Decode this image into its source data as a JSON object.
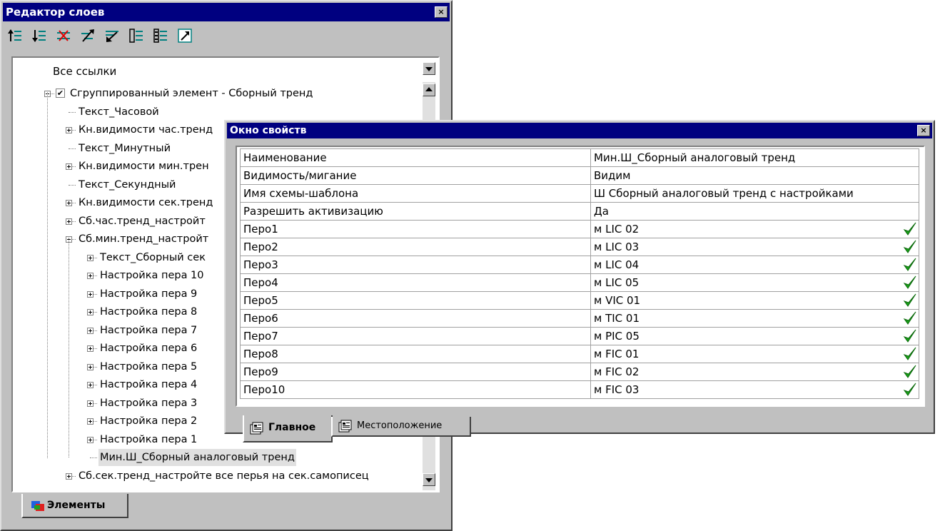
{
  "layer_editor": {
    "title": "Редактор слоев",
    "close": "×",
    "toolbar_icons": [
      "move-up-icon",
      "move-down-icon",
      "delete-link-icon",
      "link-up-icon",
      "link-down-icon",
      "list-icon",
      "numbered-list-icon",
      "jump-icon"
    ],
    "header": "Все ссылки",
    "tree": [
      {
        "label": "Сгруппированный элемент - Сборный тренд",
        "level": 0,
        "expander": "minus",
        "checked": true
      },
      {
        "label": "Текст_Часовой",
        "level": 1,
        "expander": ""
      },
      {
        "label": "Кн.видимости час.тренд",
        "level": 1,
        "expander": "plus"
      },
      {
        "label": " Текст_Минутный",
        "level": 1,
        "expander": ""
      },
      {
        "label": "Кн.видимости мин.трен",
        "level": 1,
        "expander": "plus"
      },
      {
        "label": "Текст_Секундный",
        "level": 1,
        "expander": ""
      },
      {
        "label": "Кн.видимости сек.тренд",
        "level": 1,
        "expander": "plus"
      },
      {
        "label": " Сб.час.тренд_настройт",
        "level": 1,
        "expander": "plus"
      },
      {
        "label": " Сб.мин.тренд_настройт",
        "level": 1,
        "expander": "minus"
      },
      {
        "label": "Текст_Сборный сек",
        "level": 2,
        "expander": "plus"
      },
      {
        "label": "Настройка пера 10",
        "level": 2,
        "expander": "plus"
      },
      {
        "label": "Настройка пера 9",
        "level": 2,
        "expander": "plus"
      },
      {
        "label": "Настройка пера 8",
        "level": 2,
        "expander": "plus"
      },
      {
        "label": "Настройка пера 7",
        "level": 2,
        "expander": "plus"
      },
      {
        "label": "Настройка пера 6",
        "level": 2,
        "expander": "plus"
      },
      {
        "label": "Настройка пера 5",
        "level": 2,
        "expander": "plus"
      },
      {
        "label": "Настройка пера 4",
        "level": 2,
        "expander": "plus"
      },
      {
        "label": "Настройка пера 3",
        "level": 2,
        "expander": "plus"
      },
      {
        "label": "Настройка пера 2",
        "level": 2,
        "expander": "plus"
      },
      {
        "label": "Настройка пера 1",
        "level": 2,
        "expander": "plus"
      },
      {
        "label": "Мин.Ш_Сборный аналоговый тренд",
        "level": 2,
        "expander": "",
        "selected": true
      },
      {
        "label": "Сб.сек.тренд_настройте все перья на сек.самописец",
        "level": 1,
        "expander": "plus"
      }
    ],
    "tab_label": "Элементы"
  },
  "properties": {
    "title": "Окно свойств",
    "close": "×",
    "rows": [
      {
        "name": "Наименование",
        "value": "Мин.Ш_Сборный аналоговый тренд",
        "ok": false
      },
      {
        "name": "Видимость/мигание",
        "value": "Видим",
        "ok": false
      },
      {
        "name": "Имя схемы-шаблона",
        "value": "Ш Сборный аналоговый тренд с настройками",
        "ok": false
      },
      {
        "name": "Разрешить активизацию",
        "value": "Да",
        "ok": false
      },
      {
        "name": "Перо1",
        "value": "м LIC 02",
        "ok": true
      },
      {
        "name": "Перо2",
        "value": "м LIC 03",
        "ok": true
      },
      {
        "name": "Перо3",
        "value": "м LIC 04",
        "ok": true
      },
      {
        "name": "Перо4",
        "value": "м LIC 05",
        "ok": true
      },
      {
        "name": "Перо5",
        "value": "м VIC 01",
        "ok": true
      },
      {
        "name": "Перо6",
        "value": "м TIC 01",
        "ok": true
      },
      {
        "name": "Перо7",
        "value": "м PIC 05",
        "ok": true
      },
      {
        "name": "Перо8",
        "value": "м FIC 01",
        "ok": true
      },
      {
        "name": "Перо9",
        "value": "м FIC 02",
        "ok": true
      },
      {
        "name": "Перо10",
        "value": "м FIC 03",
        "ok": true
      }
    ],
    "tabs": [
      {
        "label": "Главное",
        "active": true
      },
      {
        "label": "Местоположение",
        "active": false
      }
    ]
  },
  "colors": {
    "titlebar": "#000080",
    "face": "#c0c0c0",
    "check": "#1aa01a"
  }
}
